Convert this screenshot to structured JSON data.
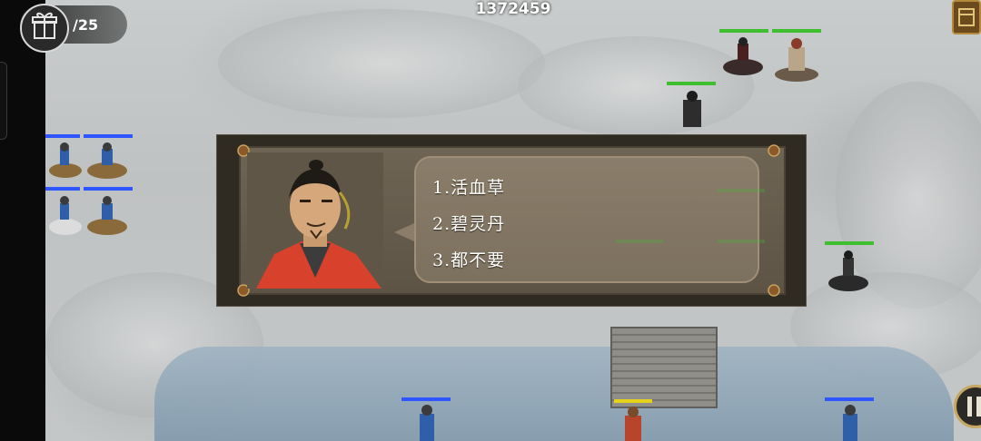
{
  "hud": {
    "score": "1372459",
    "turn": "/25",
    "menu_icon": "gift-box-icon",
    "top_right_icon": "panel-icon",
    "pause_icon": "pause-icon"
  },
  "dialog": {
    "speaker_portrait": "male-official-portrait",
    "options": [
      "1.活血草",
      "2.碧灵丹",
      "3.都不要"
    ]
  },
  "colors": {
    "ally_hp": "#2f55ff",
    "enemy_hp": "#3fbf2f",
    "leader_hp": "#e6d21a",
    "dialog_bg": "#5d5446",
    "bubble_bg": "#85786a"
  }
}
